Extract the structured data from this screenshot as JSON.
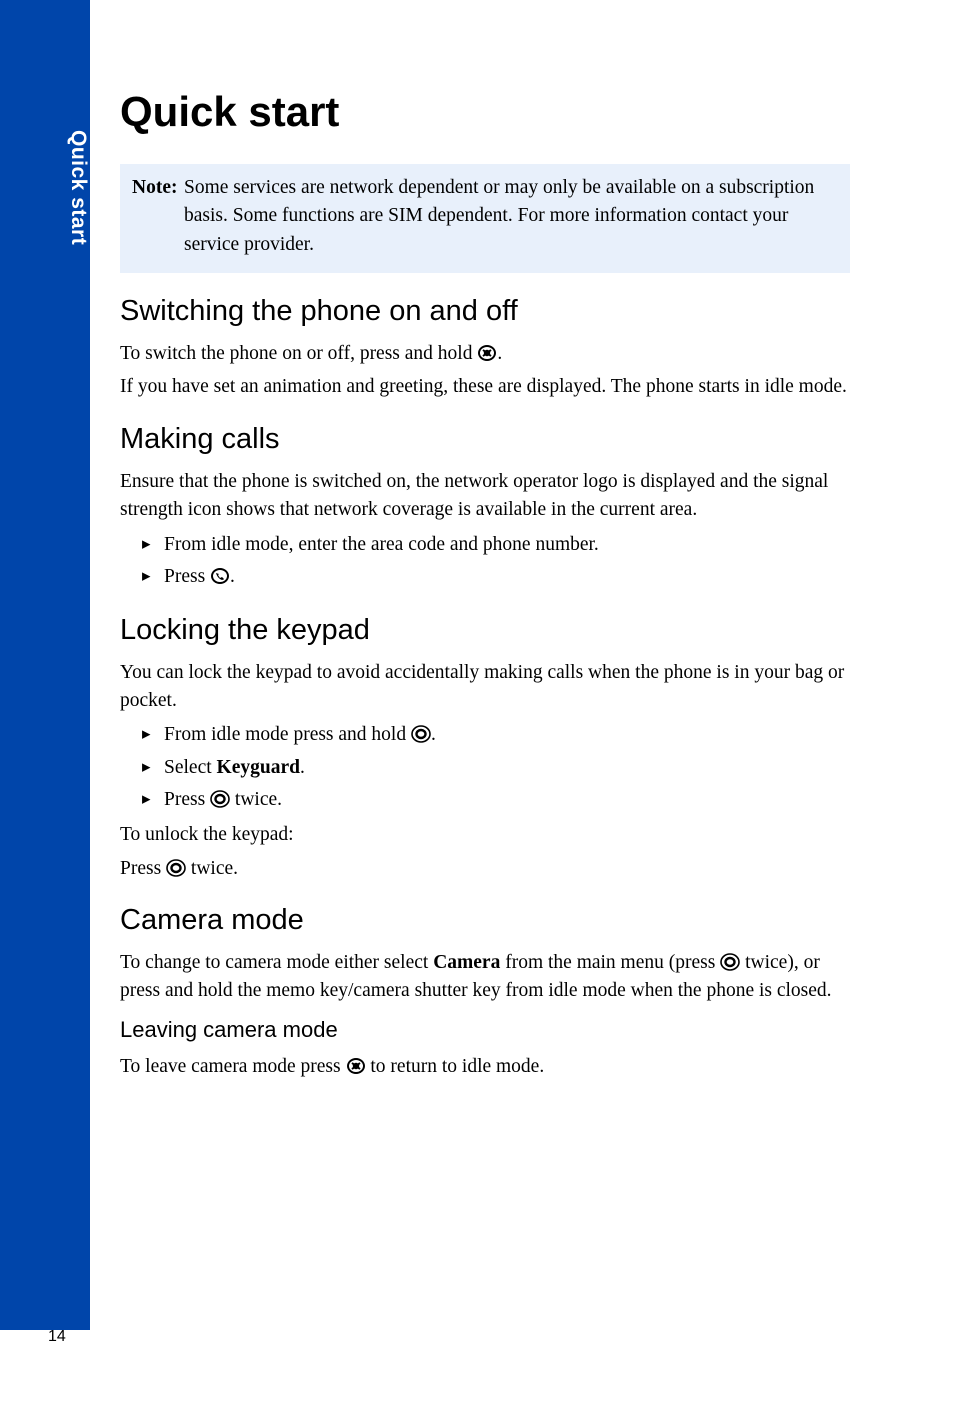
{
  "side_tab": "Quick start",
  "page_number": "14",
  "title": "Quick start",
  "note": {
    "label": "Note:",
    "text": "Some services are network dependent or may only be available on a subscription basis. Some functions are SIM dependent. For more information contact your service provider."
  },
  "s1": {
    "heading": "Switching the phone on and off",
    "p1a": "To switch the phone on or off, press and hold ",
    "p1b": ".",
    "p2": "If you have set an animation and greeting, these are displayed. The phone starts in idle mode."
  },
  "s2": {
    "heading": "Making calls",
    "p1": "Ensure that the phone is switched on, the network operator logo is displayed and the signal strength icon shows that network coverage is available in the current area.",
    "b1": "From idle mode, enter the area code and phone number.",
    "b2a": "Press ",
    "b2b": "."
  },
  "s3": {
    "heading": "Locking the keypad",
    "p1": "You can lock the keypad to avoid accidentally making calls when the phone is in your bag or pocket.",
    "b1a": "From idle mode press and hold ",
    "b1b": ".",
    "b2a": "Select ",
    "b2b": "Keyguard",
    "b2c": ".",
    "b3a": "Press ",
    "b3b": " twice.",
    "p2": "To unlock the keypad:",
    "p3a": "Press ",
    "p3b": " twice."
  },
  "s4": {
    "heading": "Camera mode",
    "p1a": "To change to camera mode either select ",
    "p1b": "Camera",
    "p1c": " from the main menu (press ",
    "p1d": " twice), or press and hold the memo key/camera shutter key from idle mode when the phone is closed.",
    "sub": "Leaving camera mode",
    "p2a": "To leave camera mode press ",
    "p2b": " to return to idle mode."
  }
}
